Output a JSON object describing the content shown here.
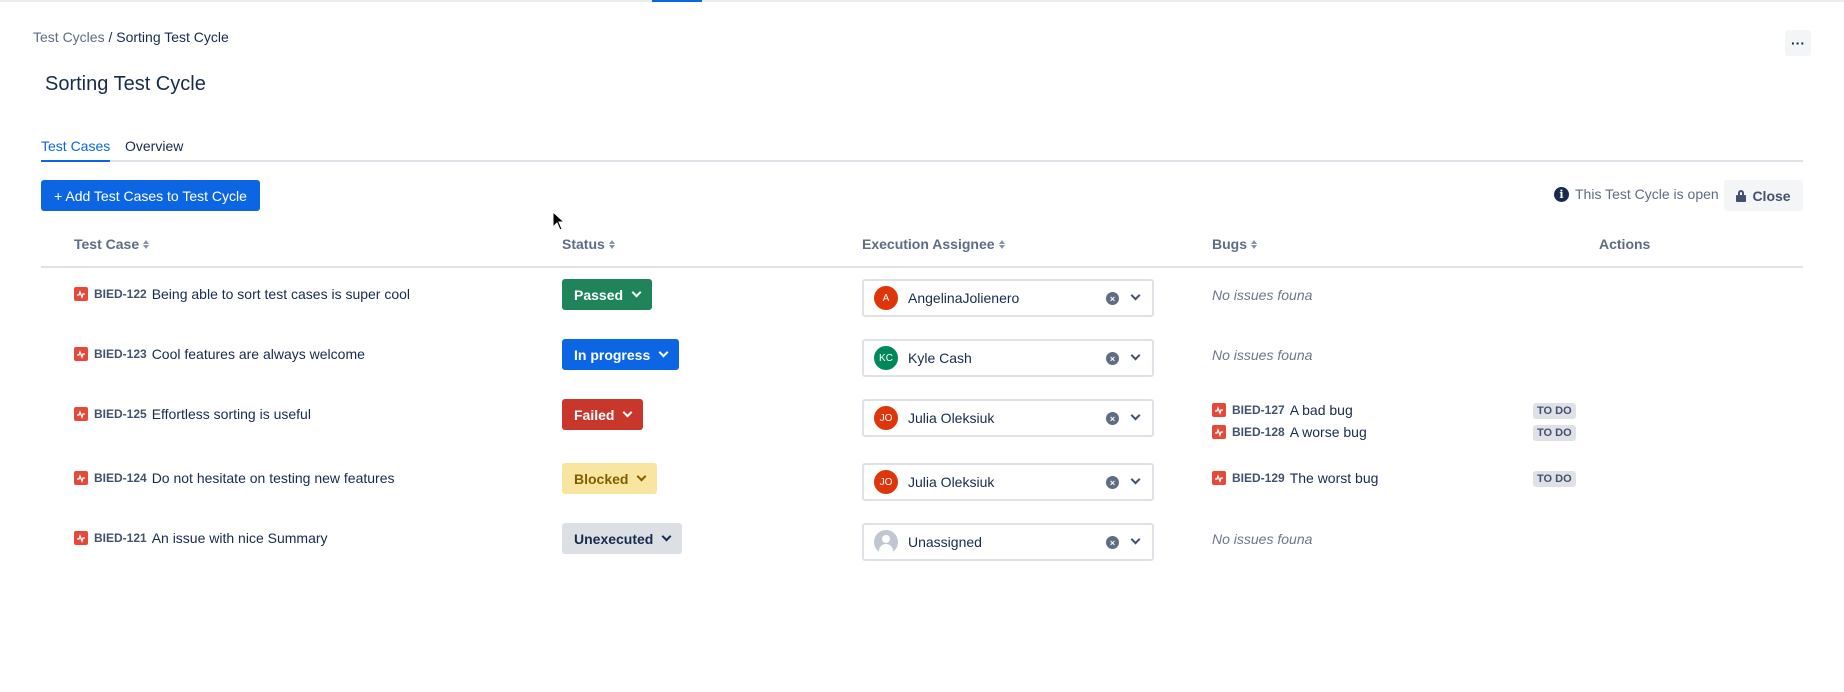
{
  "breadcrumb": {
    "parent": "Test Cycles",
    "separator": " / ",
    "current": "Sorting Test Cycle"
  },
  "header": {
    "more_label": "···",
    "title": "Sorting Test Cycle"
  },
  "tabs": [
    {
      "label": "Test Cases",
      "active": true
    },
    {
      "label": "Overview",
      "active": false
    }
  ],
  "toolbar": {
    "add_label": "+ Add Test Cases to Test Cycle",
    "cycle_state": "This Test Cycle is open",
    "close_label": "Close",
    "info_glyph": "i"
  },
  "table": {
    "columns": {
      "test_case": "Test Case",
      "status": "Status",
      "assignee": "Execution Assignee",
      "bugs": "Bugs",
      "actions": "Actions"
    },
    "rows": [
      {
        "key": "BIED-122",
        "summary": "Being able to sort test cases is super cool",
        "status": "Passed",
        "status_bg": "#1f845a",
        "status_fg": "#ffffff",
        "assignee": "AngelinaJolienero",
        "initials": "A",
        "avatar_color": "#de350b",
        "bugs_empty": "No issues founa",
        "bugs": []
      },
      {
        "key": "BIED-123",
        "summary": "Cool features are always welcome",
        "status": "In progress",
        "status_bg": "#0c66e4",
        "status_fg": "#ffffff",
        "assignee": "Kyle Cash",
        "initials": "KC",
        "avatar_color": "#00875a",
        "bugs_empty": "No issues founa",
        "bugs": []
      },
      {
        "key": "BIED-125",
        "summary": "Effortless sorting is useful",
        "status": "Failed",
        "status_bg": "#c9372c",
        "status_fg": "#ffffff",
        "assignee": "Julia Oleksiuk",
        "initials": "JO",
        "avatar_color": "#de350b",
        "bugs_empty": "",
        "bugs": [
          {
            "key": "BIED-127",
            "summary": "A bad bug",
            "status": "TO DO"
          },
          {
            "key": "BIED-128",
            "summary": "A worse bug",
            "status": "TO DO"
          }
        ]
      },
      {
        "key": "BIED-124",
        "summary": "Do not hesitate on testing new features",
        "status": "Blocked",
        "status_bg": "#f8e6a0",
        "status_fg": "#7f5f01",
        "assignee": "Julia Oleksiuk",
        "initials": "JO",
        "avatar_color": "#de350b",
        "bugs_empty": "",
        "bugs": [
          {
            "key": "BIED-129",
            "summary": "The worst bug",
            "status": "TO DO"
          }
        ]
      },
      {
        "key": "BIED-121",
        "summary": "An issue with nice Summary",
        "status": "Unexecuted",
        "status_bg": "#dcdfe4",
        "status_fg": "#172b4d",
        "assignee": "Unassigned",
        "initials": "",
        "avatar_color": "#c1c7d0",
        "bugs_empty": "No issues founa",
        "bugs": []
      }
    ]
  }
}
